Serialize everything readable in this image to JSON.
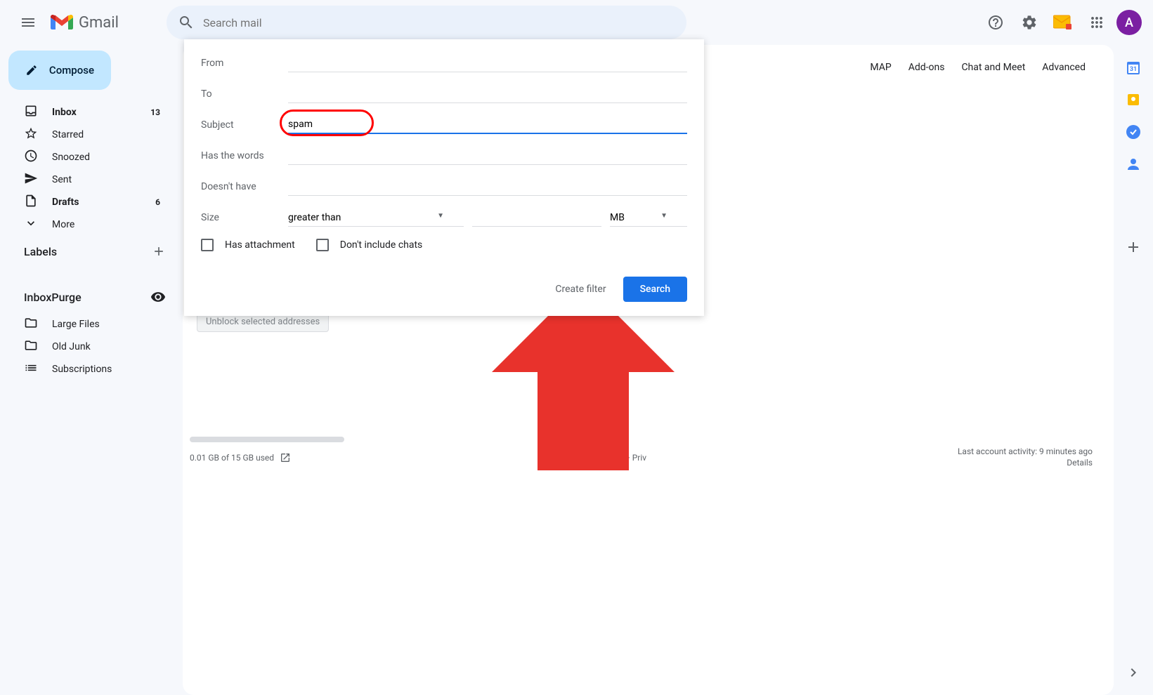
{
  "header": {
    "app_name": "Gmail",
    "search_placeholder": "Search mail",
    "avatar_letter": "A"
  },
  "compose_label": "Compose",
  "sidebar": {
    "items": [
      {
        "label": "Inbox",
        "count": "13",
        "bold": true,
        "icon": "inbox"
      },
      {
        "label": "Starred",
        "count": "",
        "bold": false,
        "icon": "star"
      },
      {
        "label": "Snoozed",
        "count": "",
        "bold": false,
        "icon": "clock"
      },
      {
        "label": "Sent",
        "count": "",
        "bold": false,
        "icon": "send"
      },
      {
        "label": "Drafts",
        "count": "6",
        "bold": true,
        "icon": "draft"
      },
      {
        "label": "More",
        "count": "",
        "bold": false,
        "icon": "chevron-down"
      }
    ],
    "labels_header": "Labels",
    "inboxpurge_header": "InboxPurge",
    "inboxpurge_items": [
      {
        "label": "Large Files",
        "icon": "folder"
      },
      {
        "label": "Old Junk",
        "icon": "folder"
      },
      {
        "label": "Subscriptions",
        "icon": "list"
      }
    ]
  },
  "settings_tabs": [
    "MAP",
    "Add-ons",
    "Chat and Meet",
    "Advanced"
  ],
  "search_form": {
    "from_label": "From",
    "to_label": "To",
    "subject_label": "Subject",
    "subject_value": "spam",
    "haswords_label": "Has the words",
    "doesnthave_label": "Doesn't have",
    "size_label": "Size",
    "size_operator": "greater than",
    "size_unit": "MB",
    "has_attachment": "Has attachment",
    "dont_include_chats": "Don't include chats",
    "create_filter": "Create filter",
    "search_button": "Search"
  },
  "main": {
    "unblock_button": "Unblock selected addresses",
    "storage": "0.01 GB of 15 GB used",
    "terms": "Terms · Priv",
    "activity": "Last account activity: 9 minutes ago",
    "details": "Details"
  }
}
